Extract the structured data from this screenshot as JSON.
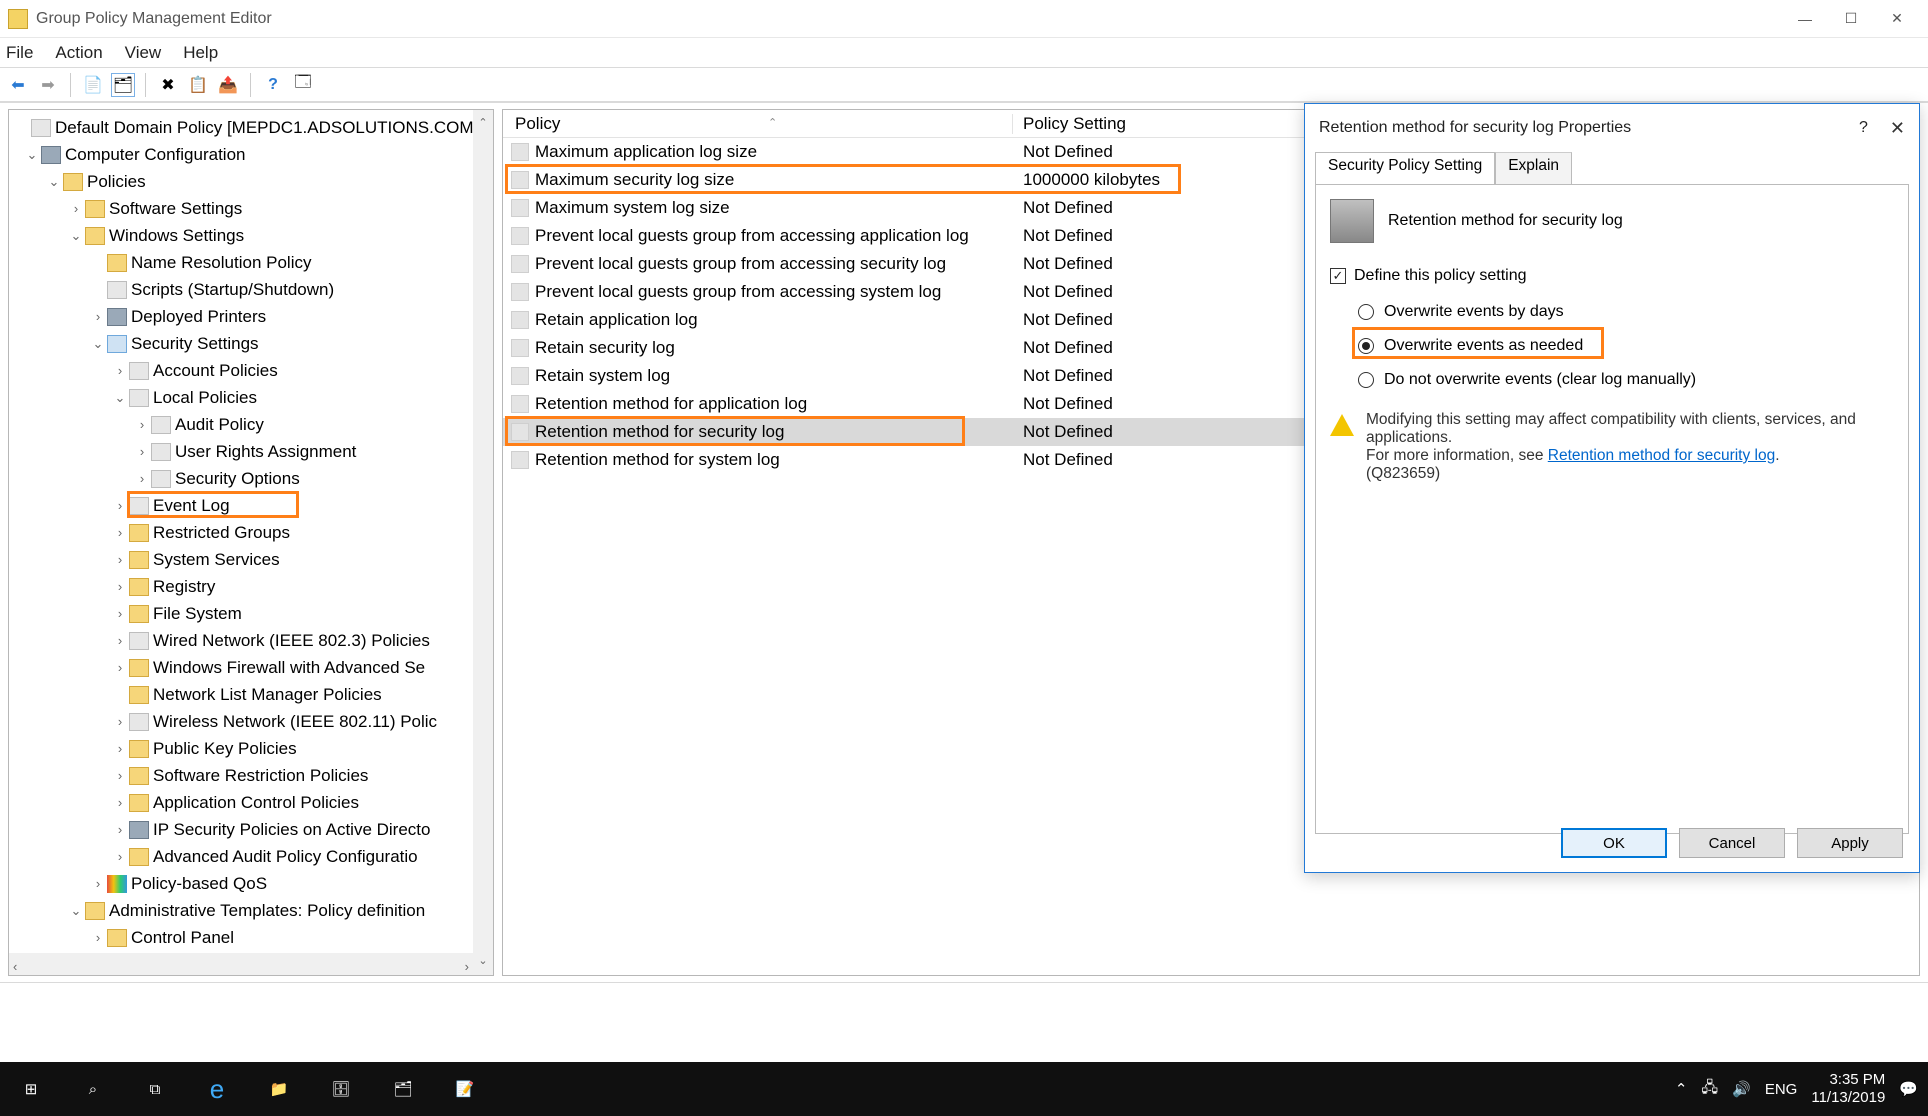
{
  "window": {
    "title": "Group Policy Management Editor"
  },
  "menu": {
    "file": "File",
    "action": "Action",
    "view": "View",
    "help": "Help"
  },
  "tree": {
    "root": "Default Domain Policy [MEPDC1.ADSOLUTIONS.COM",
    "computer_config": "Computer Configuration",
    "policies": "Policies",
    "software_settings": "Software Settings",
    "windows_settings": "Windows Settings",
    "name_res": "Name Resolution Policy",
    "scripts": "Scripts (Startup/Shutdown)",
    "deployed_printers": "Deployed Printers",
    "security_settings": "Security Settings",
    "account_policies": "Account Policies",
    "local_policies": "Local Policies",
    "audit_policy": "Audit Policy",
    "user_rights": "User Rights Assignment",
    "security_options": "Security Options",
    "event_log": "Event Log",
    "restricted_groups": "Restricted Groups",
    "system_services": "System Services",
    "registry": "Registry",
    "file_system": "File System",
    "wired_network": "Wired Network (IEEE 802.3) Policies",
    "win_firewall": "Windows Firewall with Advanced Se",
    "network_list": "Network List Manager Policies",
    "wireless_network": "Wireless Network (IEEE 802.11) Polic",
    "pubkey": "Public Key Policies",
    "software_restriction": "Software Restriction Policies",
    "app_control": "Application Control Policies",
    "ipsec": "IP Security Policies on Active Directo",
    "adv_audit": "Advanced Audit Policy Configuratio",
    "policy_qos": "Policy-based QoS",
    "admin_templates": "Administrative Templates: Policy definition",
    "control_panel": "Control Panel"
  },
  "list": {
    "header_policy": "Policy",
    "header_setting": "Policy Setting",
    "rows": [
      {
        "name": "Maximum application log size",
        "setting": "Not Defined"
      },
      {
        "name": "Maximum security log size",
        "setting": "1000000 kilobytes"
      },
      {
        "name": "Maximum system log size",
        "setting": "Not Defined"
      },
      {
        "name": "Prevent local guests group from accessing application log",
        "setting": "Not Defined"
      },
      {
        "name": "Prevent local guests group from accessing security log",
        "setting": "Not Defined"
      },
      {
        "name": "Prevent local guests group from accessing system log",
        "setting": "Not Defined"
      },
      {
        "name": "Retain application log",
        "setting": "Not Defined"
      },
      {
        "name": "Retain security log",
        "setting": "Not Defined"
      },
      {
        "name": "Retain system log",
        "setting": "Not Defined"
      },
      {
        "name": "Retention method for application log",
        "setting": "Not Defined"
      },
      {
        "name": "Retention method for security log",
        "setting": "Not Defined"
      },
      {
        "name": "Retention method for system log",
        "setting": "Not Defined"
      }
    ],
    "selected_index": 10,
    "highlighted_index": 1
  },
  "dialog": {
    "title": "Retention method for security log Properties",
    "tab1": "Security Policy Setting",
    "tab2": "Explain",
    "policy_name": "Retention method for security log",
    "define_checkbox": "Define this policy setting",
    "radio1": "Overwrite events by days",
    "radio2": "Overwrite events as needed",
    "radio3": "Do not overwrite events (clear log manually)",
    "warn_line1": "Modifying this setting may affect compatibility with clients, services, and applications.",
    "warn_line2_pre": "For more information, see ",
    "warn_link": "Retention method for security log",
    "warn_line3": "(Q823659)",
    "ok": "OK",
    "cancel": "Cancel",
    "apply": "Apply"
  },
  "taskbar": {
    "lang": "ENG",
    "time": "3:35 PM",
    "date": "11/13/2019"
  }
}
